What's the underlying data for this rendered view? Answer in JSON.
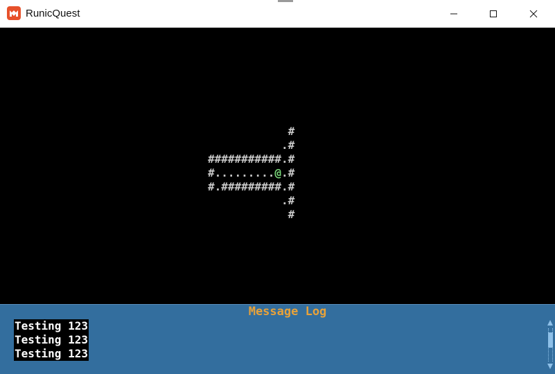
{
  "window": {
    "title": "RunicQuest",
    "app_icon": "monogame-icon",
    "controls": [
      "minimize-icon",
      "maximize-icon",
      "close-icon"
    ]
  },
  "game": {
    "map_rows": [
      "            #",
      "           .#",
      "###########.#",
      "#.........@.#",
      "#.#########.#",
      "           .#",
      "            #"
    ],
    "player_glyph": "@",
    "colors": {
      "background": "#000000",
      "wall_floor": "#c8c8c8",
      "player": "#7ad87a"
    }
  },
  "message_log": {
    "title": "Message Log",
    "messages": [
      "Testing 123",
      "Testing 123",
      "Testing 123"
    ],
    "colors": {
      "panel": "#336e9e",
      "title": "#e8a23a",
      "text": "#ffffff",
      "scrollbar": "#8ec0e8"
    }
  }
}
